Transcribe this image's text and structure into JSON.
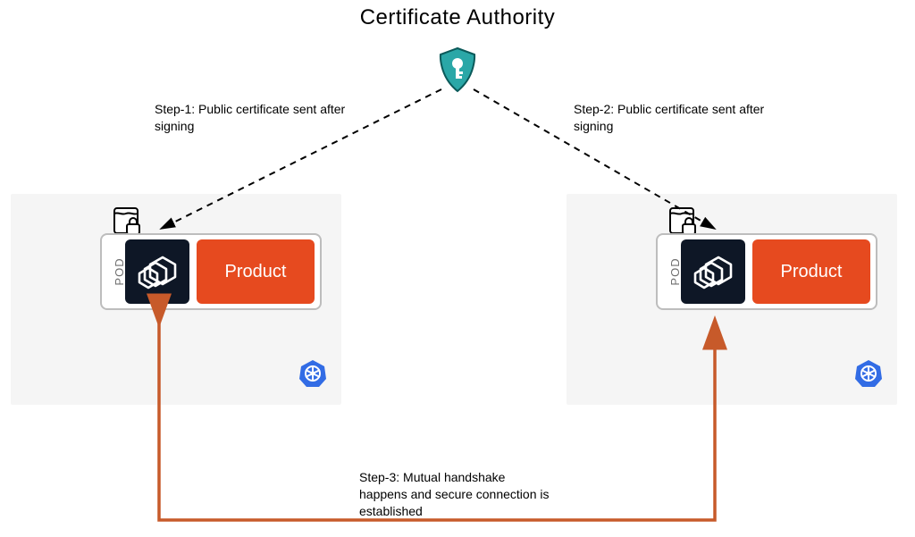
{
  "title": "Certificate Authority",
  "steps": {
    "s1": "Step-1: Public certificate sent after signing",
    "s2": "Step-2: Public certificate sent after signing",
    "s3": "Step-3: Mutual handshake happens and secure connection is established"
  },
  "pod": {
    "label": "POD",
    "product": "Product"
  },
  "colors": {
    "orange": "#e64a1f",
    "dark": "#0e1726",
    "teal": "#2aa7a7",
    "k8s": "#326ce5",
    "handshake": "#c75a2a"
  }
}
